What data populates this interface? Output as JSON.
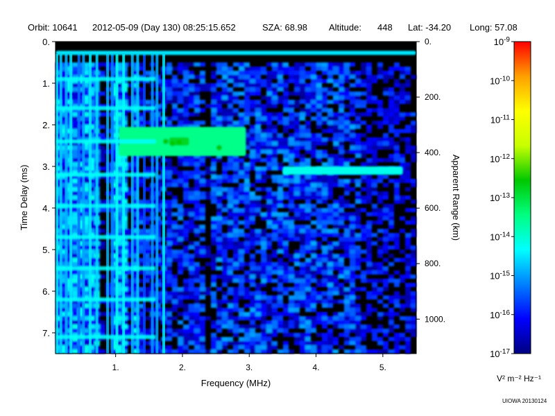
{
  "header": {
    "orbit": "Orbit: 10641",
    "datetime": "2012-05-09 (Day 130) 08:25:15.652",
    "sza": "SZA:  68.98",
    "altitude_label": "Altitude:",
    "altitude_value": "448",
    "lat": "Lat: -34.20",
    "long": "Long:  57.08"
  },
  "credit": "UIOWA 20130124",
  "colors": {
    "background": "#000000",
    "colorbar_stops": [
      "#000080",
      "#0000ff",
      "#0080ff",
      "#00ffff",
      "#00ff80",
      "#00c800",
      "#c8ff00",
      "#ffff00",
      "#ffa000",
      "#ff0000"
    ]
  },
  "chart_data": {
    "type": "heatmap",
    "title": "",
    "xlabel": "Frequency (MHz)",
    "ylabel": "Time Delay (ms)",
    "y2label": "Apparent Range (km)",
    "xlim": [
      0.1,
      5.5
    ],
    "ylim": [
      0,
      7.5
    ],
    "y_inverted": true,
    "x_ticks": [
      {
        "value": 1,
        "label": "1."
      },
      {
        "value": 2,
        "label": "2."
      },
      {
        "value": 3,
        "label": "3."
      },
      {
        "value": 4,
        "label": "4."
      },
      {
        "value": 5,
        "label": "5."
      }
    ],
    "y_ticks": [
      {
        "value": 0,
        "label": "0."
      },
      {
        "value": 1,
        "label": "1."
      },
      {
        "value": 2,
        "label": "2."
      },
      {
        "value": 3,
        "label": "3."
      },
      {
        "value": 4,
        "label": "4."
      },
      {
        "value": 5,
        "label": "5."
      },
      {
        "value": 6,
        "label": "6."
      },
      {
        "value": 7,
        "label": "7."
      }
    ],
    "y2_ticks": [
      {
        "range_km": 0,
        "delay_ms": 0,
        "label": "0."
      },
      {
        "range_km": 200,
        "delay_ms": 1.334,
        "label": "200."
      },
      {
        "range_km": 400,
        "delay_ms": 2.668,
        "label": "400."
      },
      {
        "range_km": 600,
        "delay_ms": 4.003,
        "label": "600."
      },
      {
        "range_km": 800,
        "delay_ms": 5.337,
        "label": "800."
      },
      {
        "range_km": 1000,
        "delay_ms": 6.671,
        "label": "1000."
      }
    ],
    "colorbar": {
      "label": "V² m⁻² Hz⁻¹",
      "scale": "log",
      "range": [
        1e-17,
        1e-09
      ],
      "ticks": [
        {
          "exp": -9,
          "label_base": "10",
          "label_exp": "-9"
        },
        {
          "exp": -10,
          "label_base": "10",
          "label_exp": "-10"
        },
        {
          "exp": -11,
          "label_base": "10",
          "label_exp": "-11"
        },
        {
          "exp": -12,
          "label_base": "10",
          "label_exp": "-12"
        },
        {
          "exp": -13,
          "label_base": "10",
          "label_exp": "-13"
        },
        {
          "exp": -14,
          "label_base": "10",
          "label_exp": "-14"
        },
        {
          "exp": -15,
          "label_base": "10",
          "label_exp": "-15"
        },
        {
          "exp": -16,
          "label_base": "10",
          "label_exp": "-16"
        },
        {
          "exp": -17,
          "label_base": "10",
          "label_exp": "-17"
        }
      ]
    },
    "features": [
      {
        "freq_mhz": [
          0.1,
          5.5
        ],
        "delay_ms": [
          0.22,
          0.32
        ],
        "log_intensity": -14.5
      },
      {
        "freq_mhz": [
          1.05,
          2.95
        ],
        "delay_ms": [
          2.05,
          2.75
        ],
        "log_intensity": -13.5
      },
      {
        "freq_mhz": [
          1.8,
          2.1
        ],
        "delay_ms": [
          2.3,
          2.5
        ],
        "log_intensity": -12.8
      },
      {
        "freq_mhz": [
          3.5,
          5.3
        ],
        "delay_ms": [
          3.0,
          3.2
        ],
        "log_intensity": -14.2
      },
      {
        "freq_mhz": [
          0.1,
          1.3
        ],
        "delay_ms": [
          0.2,
          7.5
        ],
        "log_intensity": -14.8
      },
      {
        "freq_mhz": [
          2.3,
          4.5
        ],
        "delay_ms": [
          0.4,
          7.5
        ],
        "log_intensity": -16.0
      },
      {
        "freq_mhz": [
          4.5,
          5.5
        ],
        "delay_ms": [
          0.4,
          7.5
        ],
        "log_intensity": -16.8
      }
    ]
  }
}
